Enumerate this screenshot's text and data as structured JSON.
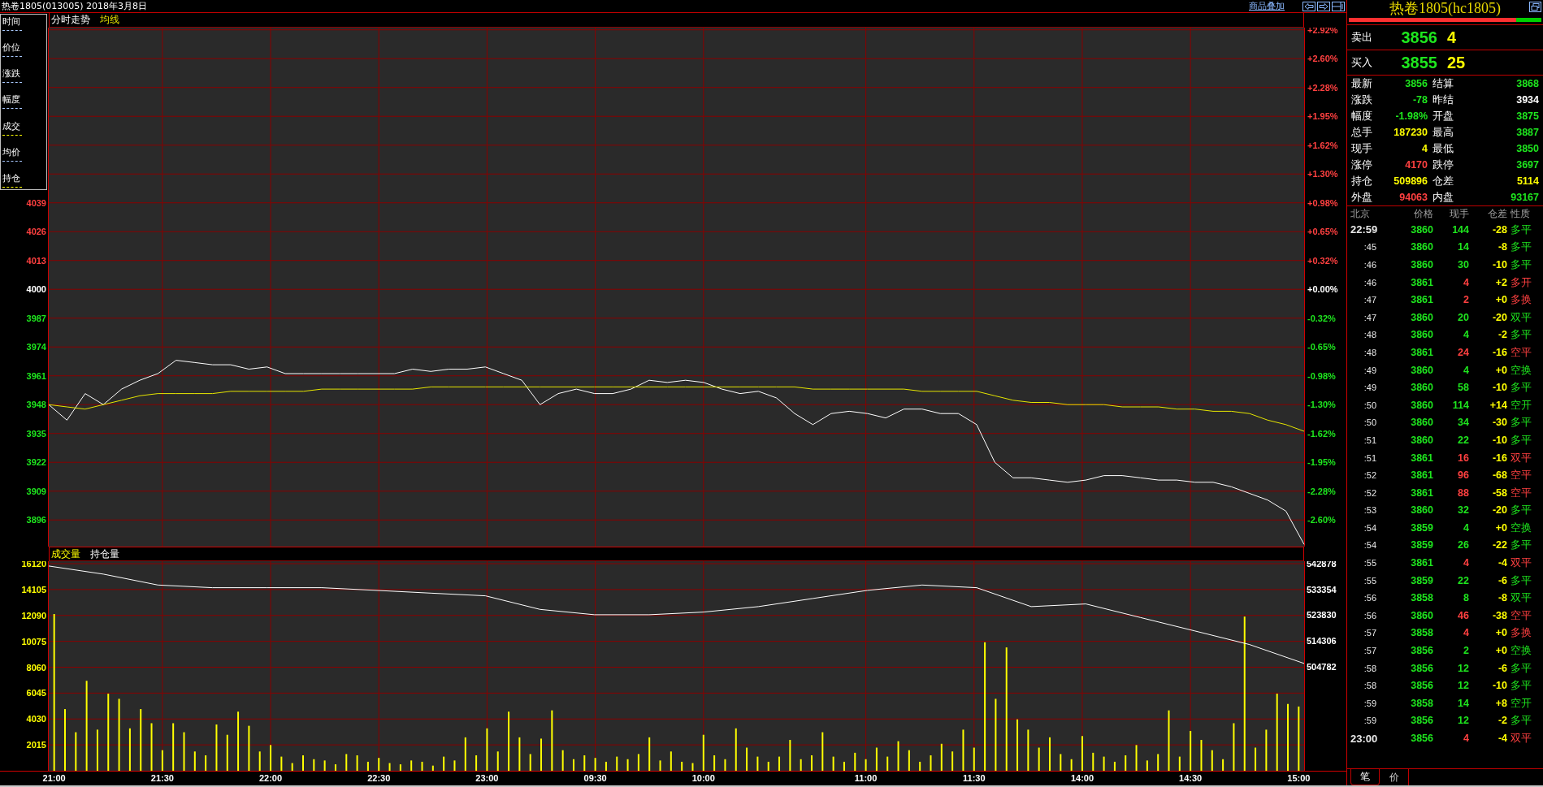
{
  "title_bar": {
    "title": "热卷1805(013005) 2018年3月8日",
    "link": "商品叠加"
  },
  "legend": [
    {
      "label": "时间",
      "color": "#a8c8ff"
    },
    {
      "label": "价位",
      "color": "#a8c8ff"
    },
    {
      "label": "涨跌",
      "color": "#a8c8ff"
    },
    {
      "label": "幅度",
      "color": "#a8c8ff"
    },
    {
      "label": "成交",
      "color": "#ffff00"
    },
    {
      "label": "均价",
      "color": "#a8c8ff"
    },
    {
      "label": "持仓",
      "color": "#ffff00"
    }
  ],
  "price_chart": {
    "percent_labels": [
      {
        "label": "+2.92%",
        "color": "#ff4040"
      },
      {
        "label": "+2.60%",
        "color": "#ff4040"
      },
      {
        "label": "+2.28%",
        "color": "#ff4040"
      },
      {
        "label": "+1.95%",
        "color": "#ff4040"
      },
      {
        "label": "+1.62%",
        "color": "#ff4040"
      },
      {
        "label": "+1.30%",
        "color": "#ff4040"
      },
      {
        "label": "+0.98%",
        "color": "#ff4040"
      },
      {
        "label": "+0.65%",
        "color": "#ff4040"
      },
      {
        "label": "+0.32%",
        "color": "#ff4040"
      },
      {
        "label": "+0.00%",
        "color": "#ffffff"
      },
      {
        "label": "-0.32%",
        "color": "#1ee61e"
      },
      {
        "label": "-0.65%",
        "color": "#1ee61e"
      },
      {
        "label": "-0.98%",
        "color": "#1ee61e"
      },
      {
        "label": "-1.30%",
        "color": "#1ee61e"
      },
      {
        "label": "-1.62%",
        "color": "#1ee61e"
      },
      {
        "label": "-1.95%",
        "color": "#1ee61e"
      },
      {
        "label": "-2.28%",
        "color": "#1ee61e"
      },
      {
        "label": "-2.60%",
        "color": "#1ee61e"
      }
    ],
    "chart_data": {
      "type": "line",
      "title": "分时走势",
      "grid": true,
      "ylim": [
        3884,
        4118
      ],
      "yticks": [
        3896,
        3909,
        3922,
        3935,
        3948,
        3961,
        3974,
        3987,
        4000,
        4013,
        4026,
        4039
      ],
      "series": [
        {
          "color": "#ffffff",
          "values": [
            3948,
            3941,
            3953,
            3948,
            3955,
            3959,
            3962,
            3968,
            3967,
            3966,
            3966,
            3964,
            3965,
            3962,
            3962,
            3962,
            3962,
            3962,
            3962,
            3962,
            3964,
            3963,
            3964,
            3964,
            3965,
            3962,
            3959,
            3948,
            3953,
            3955,
            3953,
            3953,
            3955,
            3959,
            3958,
            3959,
            3958,
            3955,
            3953,
            3954,
            3951,
            3944,
            3939,
            3944,
            3945,
            3944,
            3942,
            3946,
            3946,
            3944,
            3944,
            3939,
            3922,
            3915,
            3915,
            3914,
            3913,
            3914,
            3916,
            3916,
            3915,
            3914,
            3914,
            3913,
            3913,
            3911,
            3908,
            3905,
            3900,
            3885
          ]
        },
        {
          "name": "均线",
          "color": "#e6e600",
          "values": [
            3948,
            3947,
            3946,
            3948,
            3950,
            3952,
            3953,
            3953,
            3953,
            3953,
            3954,
            3954,
            3954,
            3954,
            3954,
            3955,
            3955,
            3955,
            3955,
            3955,
            3955,
            3956,
            3956,
            3956,
            3956,
            3956,
            3956,
            3956,
            3956,
            3956,
            3956,
            3956,
            3956,
            3956,
            3956,
            3956,
            3956,
            3956,
            3956,
            3956,
            3956,
            3956,
            3955,
            3955,
            3955,
            3955,
            3955,
            3955,
            3954,
            3954,
            3954,
            3954,
            3952,
            3950,
            3949,
            3949,
            3948,
            3948,
            3948,
            3947,
            3947,
            3947,
            3946,
            3946,
            3945,
            3945,
            3944,
            3941,
            3939,
            3936
          ]
        }
      ]
    }
  },
  "volume_chart": {
    "chart_data": {
      "type": "bar",
      "grid": true,
      "ylim": [
        0,
        16310
      ],
      "categories": [
        "21:00",
        null,
        null,
        null,
        null,
        null,
        null,
        null,
        null,
        null,
        "21:30",
        null,
        null,
        null,
        null,
        null,
        null,
        null,
        null,
        null,
        "22:00",
        null,
        null,
        null,
        null,
        null,
        null,
        null,
        null,
        null,
        "22:30",
        null,
        null,
        null,
        null,
        null,
        null,
        null,
        null,
        null,
        "23:00",
        null,
        null,
        null,
        null,
        null,
        null,
        null,
        null,
        null,
        "09:30",
        null,
        null,
        null,
        null,
        null,
        null,
        null,
        null,
        null,
        "10:00",
        null,
        null,
        null,
        null,
        null,
        null,
        null,
        null,
        null,
        null,
        null,
        null,
        null,
        null,
        "11:00",
        null,
        null,
        null,
        null,
        null,
        null,
        null,
        null,
        null,
        "11:30",
        null,
        null,
        null,
        null,
        null,
        null,
        null,
        null,
        null,
        "14:00",
        null,
        null,
        null,
        null,
        null,
        null,
        null,
        null,
        null,
        "14:30",
        null,
        null,
        null,
        null,
        null,
        null,
        null,
        null,
        null,
        "15:00"
      ],
      "yticks": [
        2015,
        4030,
        6045,
        8060,
        10075,
        12090,
        14105,
        16120
      ],
      "series": [
        {
          "name": "成交量",
          "color": "#ffff00",
          "values": [
            12200,
            4800,
            3000,
            7000,
            3200,
            6000,
            5600,
            3300,
            4800,
            3700,
            1600,
            3700,
            3000,
            1500,
            1200,
            3600,
            2800,
            4600,
            3500,
            1500,
            2000,
            1100,
            600,
            1200,
            900,
            800,
            500,
            1300,
            1200,
            700,
            1000,
            600,
            500,
            800,
            700,
            400,
            1100,
            800,
            2600,
            1200,
            3300,
            1500,
            4600,
            2600,
            1300,
            2500,
            4700,
            1600,
            900,
            1200,
            1000,
            700,
            1100,
            900,
            1300,
            2600,
            800,
            1500,
            700,
            600,
            2800,
            1200,
            900,
            3300,
            1800,
            1100,
            700,
            1100,
            2400,
            900,
            1200,
            3000,
            1100,
            700,
            1400,
            900,
            1800,
            1100,
            2300,
            1600,
            700,
            1200,
            2100,
            1500,
            3200,
            1800,
            10000,
            5600,
            9600,
            4000,
            3200,
            1800,
            2600,
            1300,
            900,
            2700,
            1400,
            1100,
            700,
            1200,
            2000,
            800,
            1300,
            4700,
            1100,
            3100,
            2400,
            1600,
            900,
            3700,
            12000,
            1800,
            3200,
            6000,
            5200,
            5000
          ]
        }
      ]
    },
    "open_interest": {
      "chart_data": {
        "type": "line",
        "ylim": [
          466378,
          543778
        ],
        "yticks": [
          504782,
          514306,
          523830,
          533354,
          542878
        ],
        "series": [
          {
            "name": "持仓量",
            "color": "#ffffff",
            "values": [
              542000,
              539000,
              535000,
              534000,
              534000,
              534000,
              533000,
              532000,
              531000,
              526000,
              524000,
              524000,
              525000,
              527000,
              530000,
              533000,
              535000,
              534000,
              527000,
              528000,
              523000,
              518000,
              513000,
              506000
            ]
          }
        ]
      }
    }
  },
  "quote_panel": {
    "title": "热卷1805(hc1805)",
    "ratio_bar": {
      "level": 0.87
    },
    "order_book": [
      {
        "label": "卖出",
        "price": "3856",
        "volume": "4"
      },
      {
        "label": "买入",
        "price": "3855",
        "volume": "25"
      }
    ],
    "stats": [
      {
        "label": "最新",
        "value": "3856",
        "color": "#1ee61e"
      },
      {
        "label": "结算",
        "value": "3868",
        "color": "#1ee61e"
      },
      {
        "label": "涨跌",
        "value": "-78",
        "color": "#1ee61e"
      },
      {
        "label": "昨结",
        "value": "3934",
        "color": "#ffffff"
      },
      {
        "label": "幅度",
        "value": "-1.98%",
        "color": "#1ee61e"
      },
      {
        "label": "开盘",
        "value": "3875",
        "color": "#1ee61e"
      },
      {
        "label": "总手",
        "value": "187230",
        "color": "#ffff00"
      },
      {
        "label": "最高",
        "value": "3887",
        "color": "#1ee61e"
      },
      {
        "label": "现手",
        "value": "4",
        "color": "#ffff00"
      },
      {
        "label": "最低",
        "value": "3850",
        "color": "#1ee61e"
      },
      {
        "label": "涨停",
        "value": "4170",
        "color": "#ff4040"
      },
      {
        "label": "跌停",
        "value": "3697",
        "color": "#1ee61e"
      },
      {
        "label": "持仓",
        "value": "509896",
        "color": "#ffff00"
      },
      {
        "label": "仓差",
        "value": "5114",
        "color": "#ffff00"
      },
      {
        "label": "外盘",
        "value": "94063",
        "color": "#ff4040"
      },
      {
        "label": "内盘",
        "value": "93167",
        "color": "#1ee61e"
      }
    ],
    "trade_columns": [
      "北京",
      "价格",
      "现手",
      "仓差",
      "性质"
    ],
    "trades": [
      {
        "time": "22:59",
        "kind": "hour",
        "price": "3860",
        "volume": "144",
        "change": "-28",
        "nature": "多平",
        "color": "#1ee61e"
      },
      {
        "time": ":45",
        "kind": "minute",
        "price": "3860",
        "volume": "14",
        "change": "-8",
        "nature": "多平",
        "color": "#1ee61e"
      },
      {
        "time": ":46",
        "kind": "minute",
        "price": "3860",
        "volume": "30",
        "change": "-10",
        "nature": "多平",
        "color": "#1ee61e"
      },
      {
        "time": ":46",
        "kind": "minute",
        "price": "3861",
        "volume": "4",
        "change": "+2",
        "nature": "多开",
        "color": "#ff4040"
      },
      {
        "time": ":47",
        "kind": "minute",
        "price": "3861",
        "volume": "2",
        "change": "+0",
        "nature": "多换",
        "color": "#ff4040"
      },
      {
        "time": ":47",
        "kind": "minute",
        "price": "3860",
        "volume": "20",
        "change": "-20",
        "nature": "双平",
        "color": "#1ee61e"
      },
      {
        "time": ":48",
        "kind": "minute",
        "price": "3860",
        "volume": "4",
        "change": "-2",
        "nature": "多平",
        "color": "#1ee61e"
      },
      {
        "time": ":48",
        "kind": "minute",
        "price": "3861",
        "volume": "24",
        "change": "-16",
        "nature": "空平",
        "color": "#ff4040"
      },
      {
        "time": ":49",
        "kind": "minute",
        "price": "3860",
        "volume": "4",
        "change": "+0",
        "nature": "空换",
        "color": "#1ee61e"
      },
      {
        "time": ":49",
        "kind": "minute",
        "price": "3860",
        "volume": "58",
        "change": "-10",
        "nature": "多平",
        "color": "#1ee61e"
      },
      {
        "time": ":50",
        "kind": "minute",
        "price": "3860",
        "volume": "114",
        "change": "+14",
        "nature": "空开",
        "color": "#1ee61e"
      },
      {
        "time": ":50",
        "kind": "minute",
        "price": "3860",
        "volume": "34",
        "change": "-30",
        "nature": "多平",
        "color": "#1ee61e"
      },
      {
        "time": ":51",
        "kind": "minute",
        "price": "3860",
        "volume": "22",
        "change": "-10",
        "nature": "多平",
        "color": "#1ee61e"
      },
      {
        "time": ":51",
        "kind": "minute",
        "price": "3861",
        "volume": "16",
        "change": "-16",
        "nature": "双平",
        "color": "#ff4040"
      },
      {
        "time": ":52",
        "kind": "minute",
        "price": "3861",
        "volume": "96",
        "change": "-68",
        "nature": "空平",
        "color": "#ff4040"
      },
      {
        "time": ":52",
        "kind": "minute",
        "price": "3861",
        "volume": "88",
        "change": "-58",
        "nature": "空平",
        "color": "#ff4040"
      },
      {
        "time": ":53",
        "kind": "minute",
        "price": "3860",
        "volume": "32",
        "change": "-20",
        "nature": "多平",
        "color": "#1ee61e"
      },
      {
        "time": ":54",
        "kind": "minute",
        "price": "3859",
        "volume": "4",
        "change": "+0",
        "nature": "空换",
        "color": "#1ee61e"
      },
      {
        "time": ":54",
        "kind": "minute",
        "price": "3859",
        "volume": "26",
        "change": "-22",
        "nature": "多平",
        "color": "#1ee61e"
      },
      {
        "time": ":55",
        "kind": "minute",
        "price": "3861",
        "volume": "4",
        "change": "-4",
        "nature": "双平",
        "color": "#ff4040"
      },
      {
        "time": ":55",
        "kind": "minute",
        "price": "3859",
        "volume": "22",
        "change": "-6",
        "nature": "多平",
        "color": "#1ee61e"
      },
      {
        "time": ":56",
        "kind": "minute",
        "price": "3858",
        "volume": "8",
        "change": "-8",
        "nature": "双平",
        "color": "#1ee61e"
      },
      {
        "time": ":56",
        "kind": "minute",
        "price": "3860",
        "volume": "46",
        "change": "-38",
        "nature": "空平",
        "color": "#ff4040"
      },
      {
        "time": ":57",
        "kind": "minute",
        "price": "3858",
        "volume": "4",
        "change": "+0",
        "nature": "多换",
        "color": "#ff4040"
      },
      {
        "time": ":57",
        "kind": "minute",
        "price": "3856",
        "volume": "2",
        "change": "+0",
        "nature": "空换",
        "color": "#1ee61e"
      },
      {
        "time": ":58",
        "kind": "minute",
        "price": "3856",
        "volume": "12",
        "change": "-6",
        "nature": "多平",
        "color": "#1ee61e"
      },
      {
        "time": ":58",
        "kind": "minute",
        "price": "3856",
        "volume": "12",
        "change": "-10",
        "nature": "多平",
        "color": "#1ee61e"
      },
      {
        "time": ":59",
        "kind": "minute",
        "price": "3858",
        "volume": "14",
        "change": "+8",
        "nature": "空开",
        "color": "#1ee61e"
      },
      {
        "time": ":59",
        "kind": "minute",
        "price": "3856",
        "volume": "12",
        "change": "-2",
        "nature": "多平",
        "color": "#1ee61e"
      },
      {
        "time": "23:00",
        "kind": "hour",
        "price": "3856",
        "volume": "4",
        "change": "-4",
        "nature": "双平",
        "color": "#ff4040"
      }
    ],
    "tabs": [
      {
        "label": "笔",
        "selected": true
      },
      {
        "label": "价",
        "selected": false
      }
    ]
  }
}
